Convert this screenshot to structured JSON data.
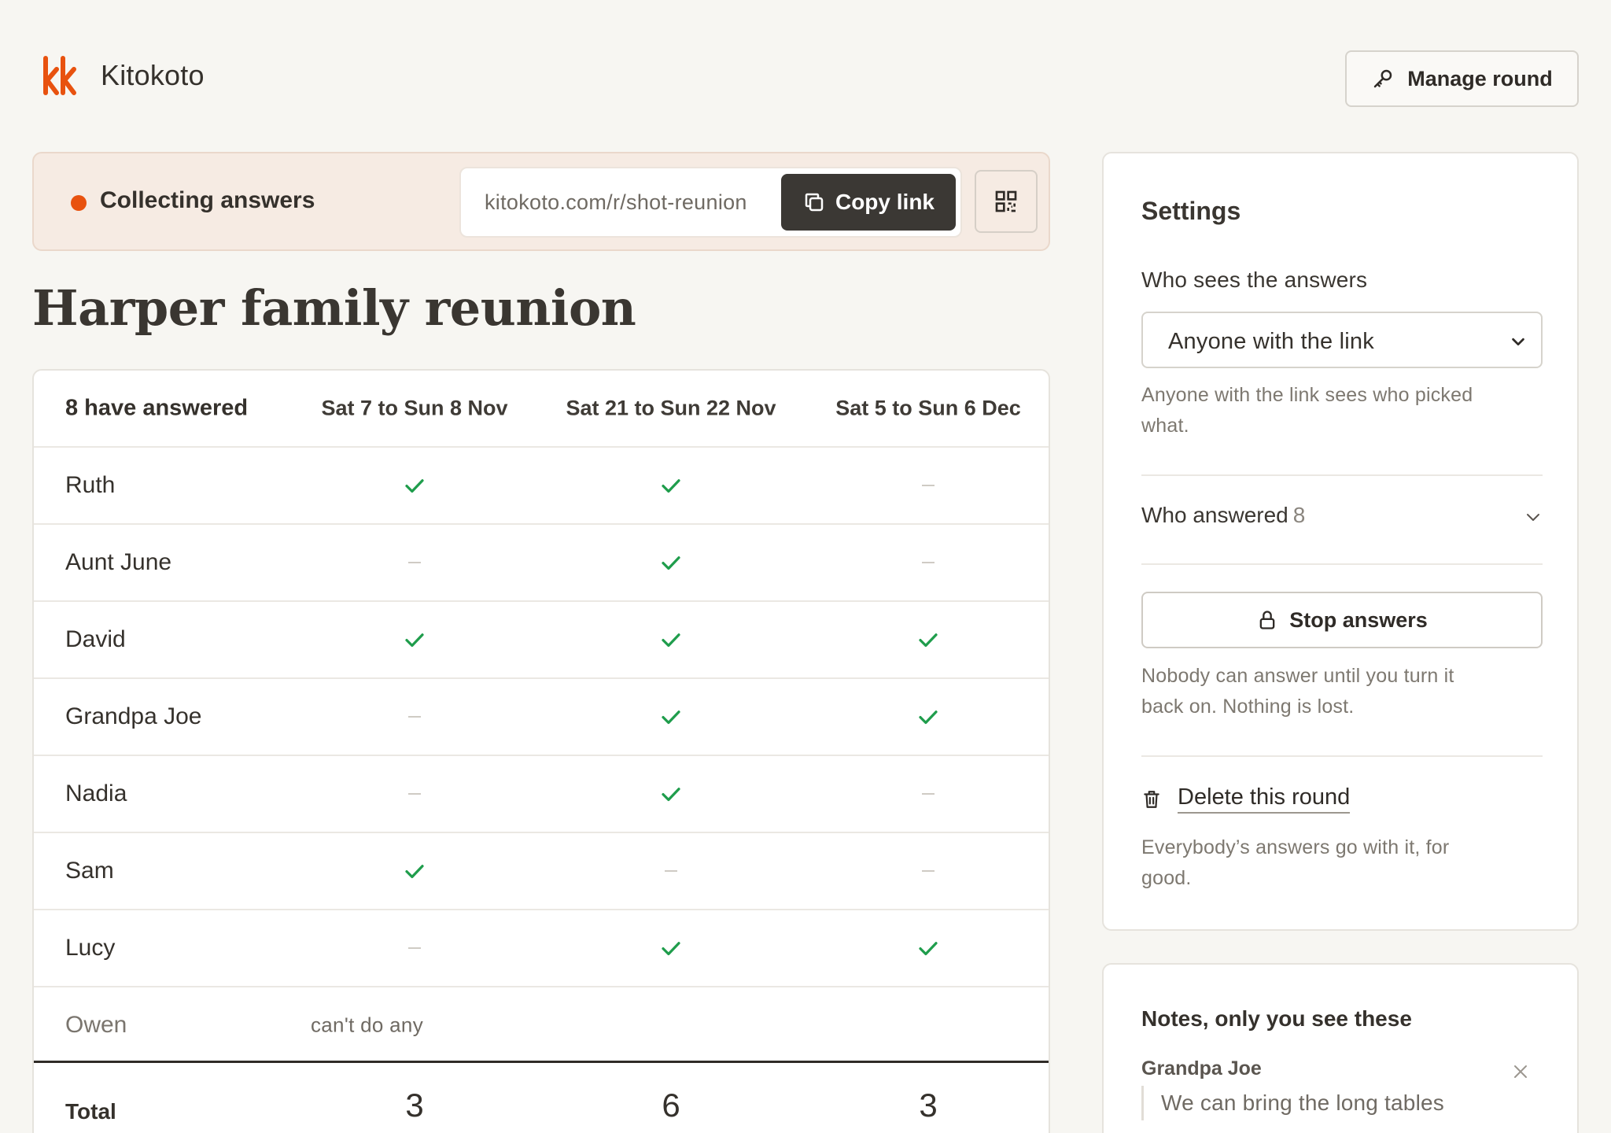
{
  "app": {
    "name": "Kitokoto",
    "logo_icon": "kk-logo-icon",
    "accent": "#e8520f"
  },
  "header": {
    "manage_label": "Manage round",
    "manage_icon": "key-icon"
  },
  "banner": {
    "status": "Collecting answers",
    "status_color": "#e8520f",
    "link": "kitokoto.com/r/shot-reunion",
    "copy_label": "Copy link",
    "copy_icon": "copy-icon",
    "qr_icon": "qr-code-icon"
  },
  "page": {
    "title": "Harper family reunion"
  },
  "table": {
    "answered_label": "8 have answered",
    "columns": [
      "Sat 7 to Sun 8 Nov",
      "Sat 21 to Sun 22 Nov",
      "Sat 5 to Sun 6 Dec"
    ],
    "rows": [
      {
        "name": "Ruth",
        "answers": [
          true,
          true,
          false
        ]
      },
      {
        "name": "Aunt June",
        "answers": [
          false,
          true,
          false
        ]
      },
      {
        "name": "David",
        "answers": [
          true,
          true,
          true
        ]
      },
      {
        "name": "Grandpa Joe",
        "answers": [
          false,
          true,
          true
        ]
      },
      {
        "name": "Nadia",
        "answers": [
          false,
          true,
          false
        ]
      },
      {
        "name": "Sam",
        "answers": [
          true,
          false,
          false
        ]
      },
      {
        "name": "Lucy",
        "answers": [
          false,
          true,
          true
        ]
      }
    ],
    "declined": {
      "name": "Owen",
      "note": "can't do any"
    },
    "total_label": "Total",
    "totals": [
      "3",
      "6",
      "3"
    ],
    "check_color": "#1f9d4c"
  },
  "settings": {
    "title": "Settings",
    "visibility_label": "Who sees the answers",
    "visibility_value": "Anyone with the link",
    "visibility_help": "Anyone with the link sees who picked what.",
    "answered_label": "Who answered",
    "answered_count": "8",
    "stop_label": "Stop answers",
    "stop_icon": "lock-icon",
    "stop_help": "Nobody can answer until you turn it back on. Nothing is lost.",
    "delete_label": "Delete this round",
    "delete_icon": "trash-icon",
    "delete_help": "Everybody’s answers go with it, for good."
  },
  "notes": {
    "title": "Notes, only you see these",
    "items": [
      {
        "author": "Grandpa Joe",
        "text": "We can bring the long tables"
      }
    ]
  }
}
